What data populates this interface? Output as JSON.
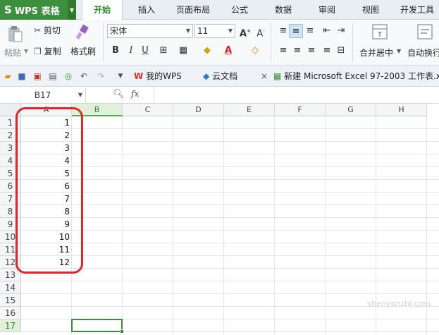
{
  "app": {
    "logo": "WPS 表格"
  },
  "menu_tabs": [
    {
      "label": "开始",
      "active": true
    },
    {
      "label": "插入",
      "active": false
    },
    {
      "label": "页面布局",
      "active": false
    },
    {
      "label": "公式",
      "active": false
    },
    {
      "label": "数据",
      "active": false
    },
    {
      "label": "审阅",
      "active": false
    },
    {
      "label": "视图",
      "active": false
    },
    {
      "label": "开发工具",
      "active": false
    }
  ],
  "ribbon": {
    "paste": "粘贴",
    "cut": "剪切",
    "copy": "复制",
    "format_painter": "格式刷",
    "font_name": "宋体",
    "font_size": "11",
    "bold": "B",
    "italic": "I",
    "underline": "U",
    "font_color_glyph": "A",
    "merge_center": "合并居中",
    "wrap_text": "自动换行"
  },
  "doc_tabs": [
    {
      "label": "我的WPS",
      "icon": "wps-logo-icon"
    },
    {
      "label": "云文档",
      "icon": "cloud-doc-icon"
    },
    {
      "label": "新建 Microsoft Excel 97-2003 工作表.x",
      "icon": "excel-doc-icon"
    }
  ],
  "formula_bar": {
    "name_box": "B17",
    "fx": "fx",
    "formula": ""
  },
  "sheet": {
    "columns": [
      "A",
      "B",
      "C",
      "D",
      "E",
      "F",
      "G",
      "H"
    ],
    "active_column": "B",
    "rows": [
      "1",
      "2",
      "3",
      "4",
      "5",
      "6",
      "7",
      "8",
      "9",
      "10",
      "11",
      "12",
      "13",
      "14",
      "15",
      "16",
      "17"
    ],
    "active_row": "17",
    "column_a_values": [
      "1",
      "2",
      "3",
      "4",
      "5",
      "6",
      "7",
      "8",
      "9",
      "10",
      "11",
      "12"
    ]
  },
  "colors": {
    "accent_green": "#3d8b3d",
    "annotation_red": "#e0262a"
  },
  "watermark": "shenyanzhi.com"
}
